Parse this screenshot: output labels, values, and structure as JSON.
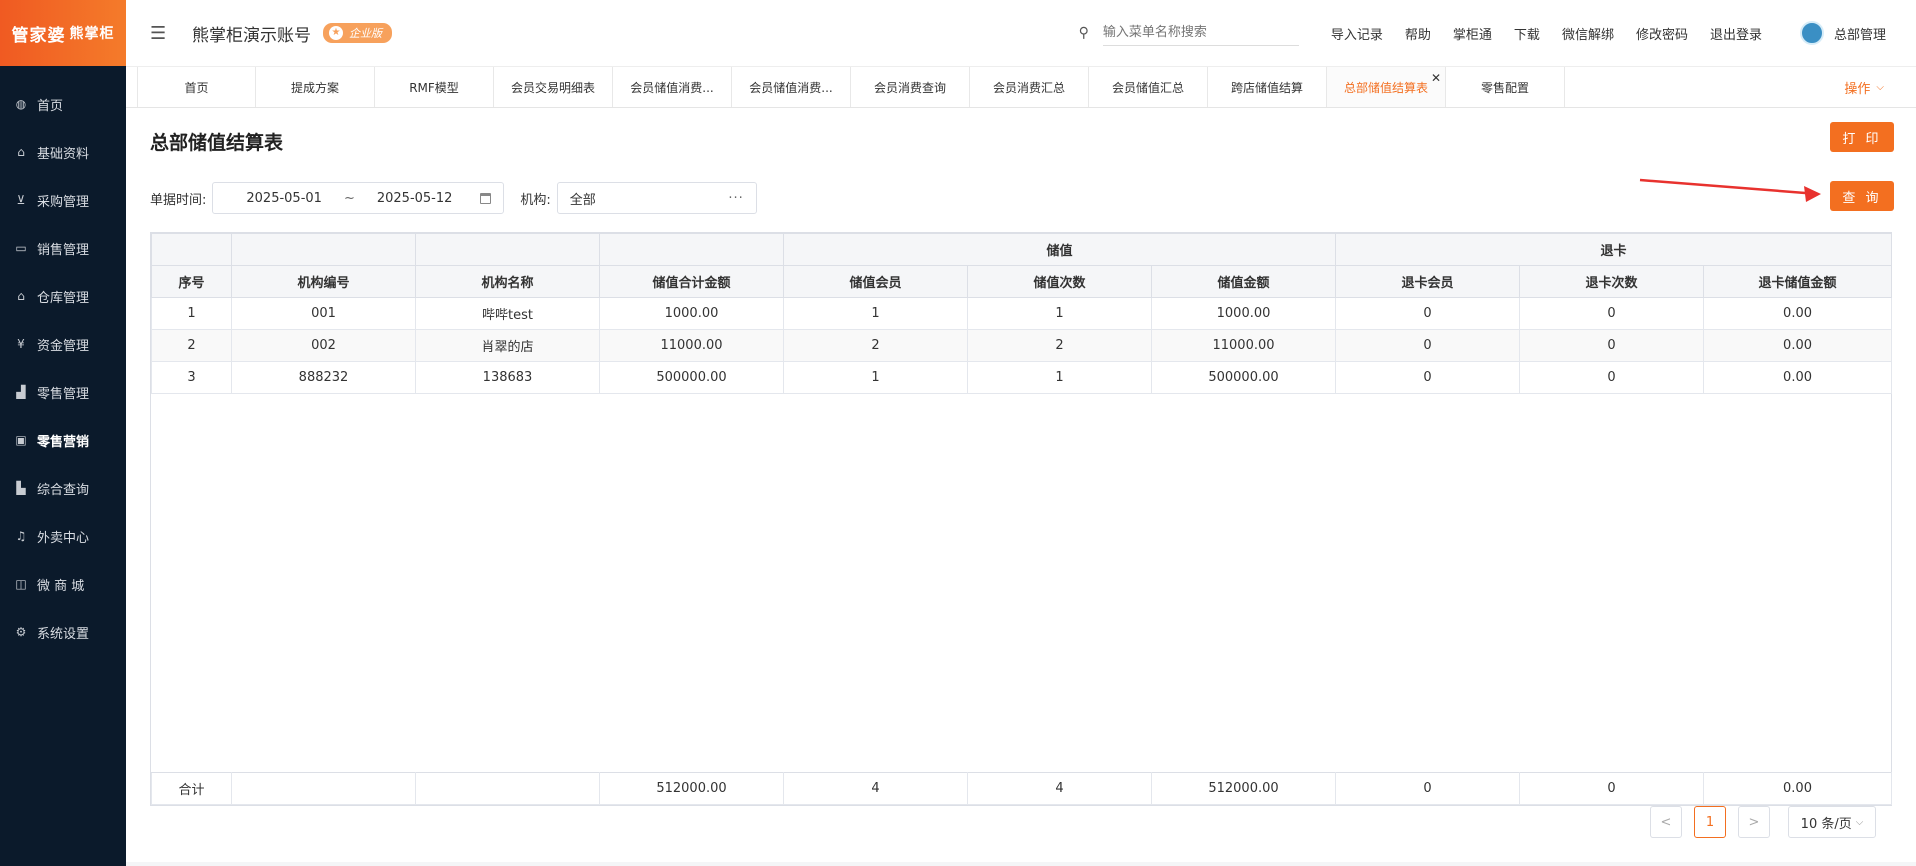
{
  "brand": {
    "logo_text": "管家婆",
    "logo_sub": "熊掌柜"
  },
  "sidebar": {
    "items": [
      {
        "label": "首页",
        "icon": "globe-icon"
      },
      {
        "label": "基础资料",
        "icon": "home-icon"
      },
      {
        "label": "采购管理",
        "icon": "cart-icon"
      },
      {
        "label": "销售管理",
        "icon": "sales-icon"
      },
      {
        "label": "仓库管理",
        "icon": "warehouse-icon"
      },
      {
        "label": "资金管理",
        "icon": "money-icon"
      },
      {
        "label": "零售管理",
        "icon": "chart-icon"
      },
      {
        "label": "零售营销",
        "icon": "gift-icon"
      },
      {
        "label": "综合查询",
        "icon": "bar-chart-icon"
      },
      {
        "label": "外卖中心",
        "icon": "bell-icon"
      },
      {
        "label": "微 商 城",
        "icon": "bag-icon"
      },
      {
        "label": "系统设置",
        "icon": "gear-icon"
      }
    ]
  },
  "header": {
    "account_name": "熊掌柜演示账号",
    "edition_badge": "企业版",
    "search_placeholder": "输入菜单名称搜索",
    "links": [
      "导入记录",
      "帮助",
      "掌柜通",
      "下载",
      "微信解绑",
      "修改密码",
      "退出登录"
    ],
    "user_name": "总部管理"
  },
  "tabs": {
    "items": [
      "首页",
      "提成方案",
      "RMF模型",
      "会员交易明细表",
      "会员储值消费...",
      "会员储值消费...",
      "会员消费查询",
      "会员消费汇总",
      "会员储值汇总",
      "跨店储值结算",
      "总部储值结算表",
      "零售配置"
    ],
    "active": "总部储值结算表",
    "ops_label": "操作"
  },
  "page": {
    "title": "总部储值结算表",
    "print_label": "打 印",
    "query_label": "查 询",
    "date_label": "单据时间:",
    "date_from": "2025-05-01",
    "date_sep": "~",
    "date_to": "2025-05-12",
    "org_label": "机构:",
    "org_value": "全部",
    "org_more": "···"
  },
  "table": {
    "group_headers": {
      "stored": "储值",
      "refund": "退卡"
    },
    "headers": [
      "序号",
      "机构编号",
      "机构名称",
      "储值合计金额",
      "储值会员",
      "储值次数",
      "储值金额",
      "退卡会员",
      "退卡次数",
      "退卡储值金额"
    ],
    "rows": [
      [
        "1",
        "001",
        "哔哔test",
        "1000.00",
        "1",
        "1",
        "1000.00",
        "0",
        "0",
        "0.00"
      ],
      [
        "2",
        "002",
        "肖翠的店",
        "11000.00",
        "2",
        "2",
        "11000.00",
        "0",
        "0",
        "0.00"
      ],
      [
        "3",
        "888232",
        "138683",
        "500000.00",
        "1",
        "1",
        "500000.00",
        "0",
        "0",
        "0.00"
      ]
    ],
    "footer": [
      "合计",
      "",
      "",
      "512000.00",
      "4",
      "4",
      "512000.00",
      "0",
      "0",
      "0.00"
    ]
  },
  "pager": {
    "prev": "<",
    "current": "1",
    "next": ">",
    "page_size": "10 条/页"
  },
  "colors": {
    "accent": "#f36f20",
    "sidebar_bg": "#0b1a2b"
  }
}
